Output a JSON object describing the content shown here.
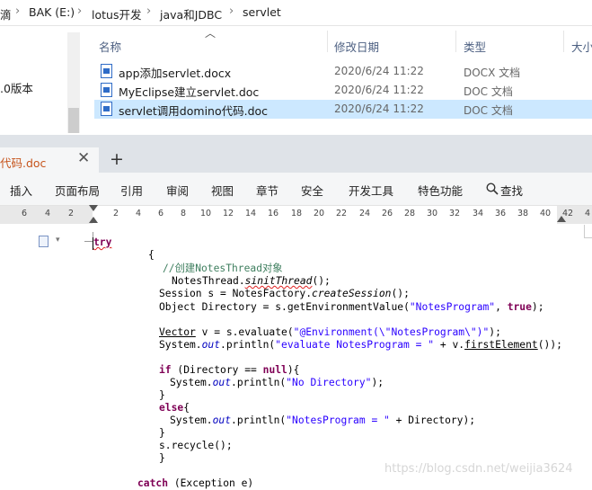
{
  "explorer": {
    "breadcrumb": [
      "滴",
      "BAK (E:)",
      "lotus开发",
      "java和JDBC",
      "servlet"
    ],
    "nav_item": ".0版本",
    "headers": {
      "name": "名称",
      "date": "修改日期",
      "type": "类型",
      "size": "大小"
    },
    "files": [
      {
        "name": "app添加servlet.docx",
        "date": "2020/6/24 11:22",
        "type": "DOCX 文档",
        "selected": false
      },
      {
        "name": "MyEclipse建立servlet.doc",
        "date": "2020/6/24 11:22",
        "type": "DOC 文档",
        "selected": false
      },
      {
        "name": "servlet调用domino代码.doc",
        "date": "2020/6/24 11:22",
        "type": "DOC 文档",
        "selected": true
      }
    ]
  },
  "wps": {
    "tab_label": "代码.doc",
    "tab_close": "✕",
    "new_tab": "+",
    "menu": [
      "插入",
      "页面布局",
      "引用",
      "审阅",
      "视图",
      "章节",
      "安全",
      "开发工具",
      "特色功能",
      "查找"
    ],
    "ruler": [
      "6",
      "4",
      "2",
      "2",
      "4",
      "6",
      "8",
      "10",
      "12",
      "14",
      "16",
      "18",
      "20",
      "22",
      "24",
      "26",
      "28",
      "30",
      "32",
      "34",
      "36",
      "38",
      "40",
      "42",
      "4"
    ]
  },
  "code": {
    "l1": "try",
    "l2": "{",
    "l3": "//创建NotesThread对象",
    "l4a": "NotesThread.",
    "l4b": "sinitThread",
    "l4c": "();",
    "l5a": "Session s = NotesFactory.",
    "l5b": "createSession",
    "l5c": "();",
    "l6a": "Object Directory = s.",
    "l6b": "getEnvironmentValue",
    "l6c": "(",
    "l6d": "\"NotesProgram\"",
    "l6e": ", ",
    "l6f": "true",
    "l6g": ");",
    "l7a": "Vector",
    "l7b": " v = s.evaluate(",
    "l7c": "\"@Environment(\\\"NotesProgram\\\")\"",
    "l7d": ");",
    "l8a": "System.",
    "l8b": "out",
    "l8c": ".println(",
    "l8d": "\"evaluate NotesProgram = \"",
    "l8e": " + v.",
    "l8f": "firstElement",
    "l8g": "());",
    "l9a": "if",
    "l9b": " (Directory == ",
    "l9c": "null",
    "l9d": "){",
    "l10a": "System.",
    "l10b": "out",
    "l10c": ".println(",
    "l10d": "\"No Directory\"",
    "l10e": ");",
    "l11": "}",
    "l12a": "else",
    "l12b": "{",
    "l13a": "System.",
    "l13b": "out",
    "l13c": ".println(",
    "l13d": "\"NotesProgram = \"",
    "l13e": " + Directory);",
    "l14": "}",
    "l15": "s.recycle();",
    "l16": "}",
    "l17a": "catch",
    "l17b": " (Exception e)"
  },
  "watermark": "https://blog.csdn.net/weijia3624"
}
